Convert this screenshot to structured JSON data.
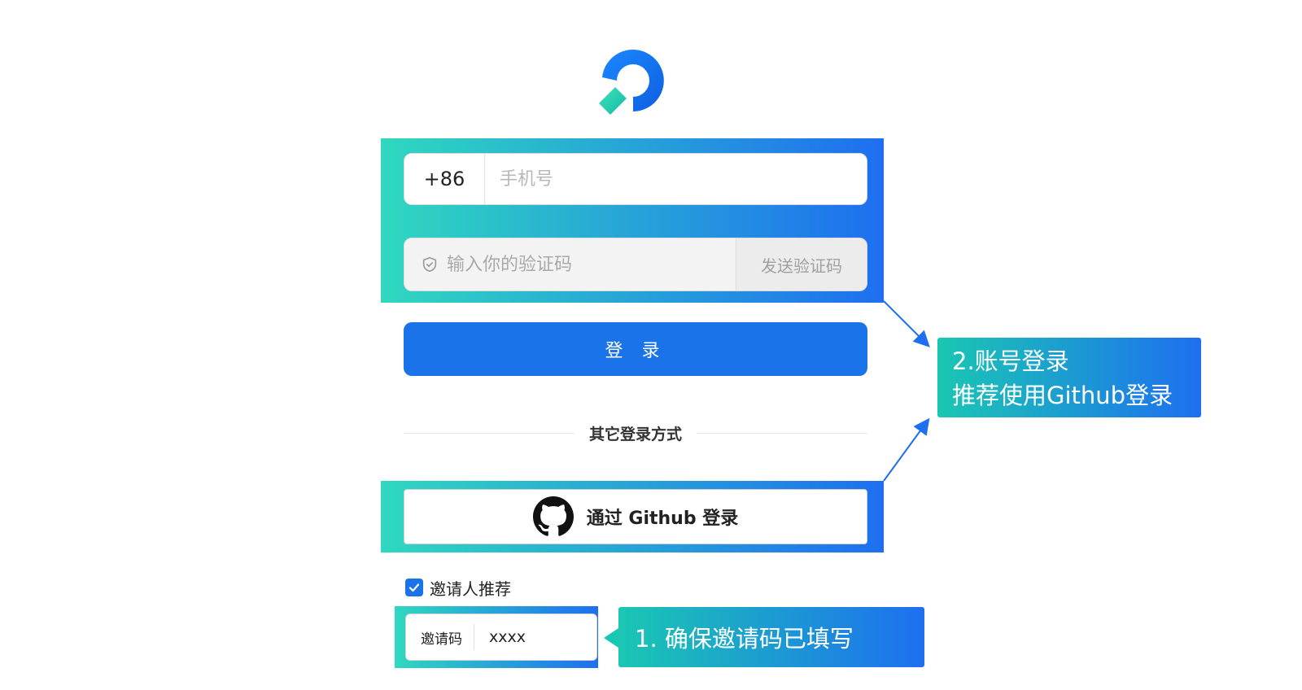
{
  "colors": {
    "primary": "#1a73e8",
    "highlight_gradient_start": "#2fd8bf",
    "highlight_gradient_end": "#1e6ff0"
  },
  "logo": {
    "icon": "brand-logo-icon"
  },
  "phone": {
    "country_code": "+86",
    "placeholder": "手机号",
    "value": ""
  },
  "verify": {
    "icon": "shield-check-icon",
    "placeholder": "输入你的验证码",
    "value": "",
    "send_label": "发送验证码"
  },
  "login": {
    "label": "登 录"
  },
  "other_methods": {
    "label": "其它登录方式"
  },
  "github": {
    "icon": "github-icon",
    "label": "通过 Github 登录"
  },
  "invite": {
    "checked": true,
    "checkbox_label": "邀请人推荐",
    "code_label": "邀请码",
    "code_value": "xxxx"
  },
  "callouts": {
    "account_login": {
      "line1": "2.账号登录",
      "line2": "推荐使用Github登录"
    },
    "invite_code": {
      "text": "1. 确保邀请码已填写"
    }
  }
}
